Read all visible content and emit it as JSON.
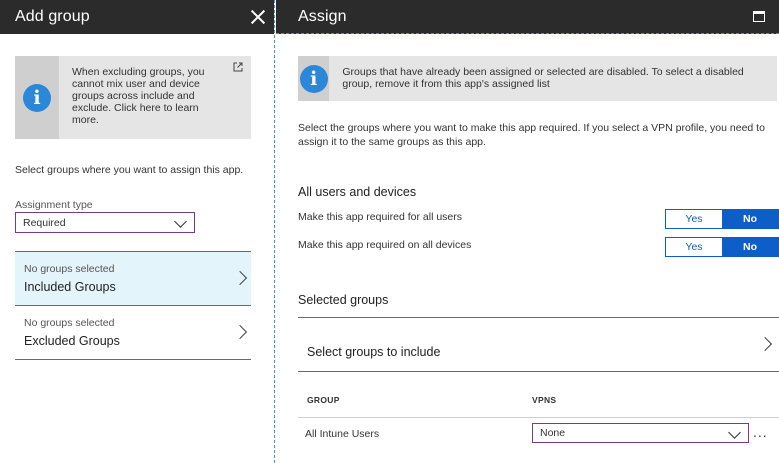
{
  "left_blade": {
    "title": "Add group",
    "info_text": "When excluding groups, you cannot mix user and device groups across include and exclude.  Click here to learn more.",
    "instruction": "Select groups where you want to assign this app.",
    "assignment_type_label": "Assignment type",
    "assignment_type_value": "Required",
    "included": {
      "sub": "No groups selected",
      "label": "Included Groups"
    },
    "excluded": {
      "sub": "No groups selected",
      "label": "Excluded Groups"
    }
  },
  "right_blade": {
    "title": "Assign",
    "info_text": "Groups that have already been assigned or selected are disabled. To select a disabled group, remove it from this app's assigned list",
    "description": "Select the groups where you want to make this app required. If you select a VPN profile, you need to assign it to the same groups as this app.",
    "all_users_devices_title": "All users and devices",
    "toggles": [
      {
        "label": "Make this app required for all users",
        "yes": "Yes",
        "no": "No",
        "selected": "No"
      },
      {
        "label": "Make this app required on all devices",
        "yes": "Yes",
        "no": "No",
        "selected": "No"
      }
    ],
    "selected_groups_title": "Selected groups",
    "select_include_label": "Select groups to include",
    "table": {
      "columns": [
        "GROUP",
        "VPNS"
      ],
      "rows": [
        {
          "group": "All Intune Users",
          "vpns": "None",
          "more": "..."
        }
      ]
    }
  },
  "colors": {
    "header_bg": "#2b2b2b",
    "accent_blue": "#0e5ec9",
    "info_icon": "#2b88d8",
    "focus_border": "#7a3a8a",
    "selected_row": "#e3f4fa"
  }
}
